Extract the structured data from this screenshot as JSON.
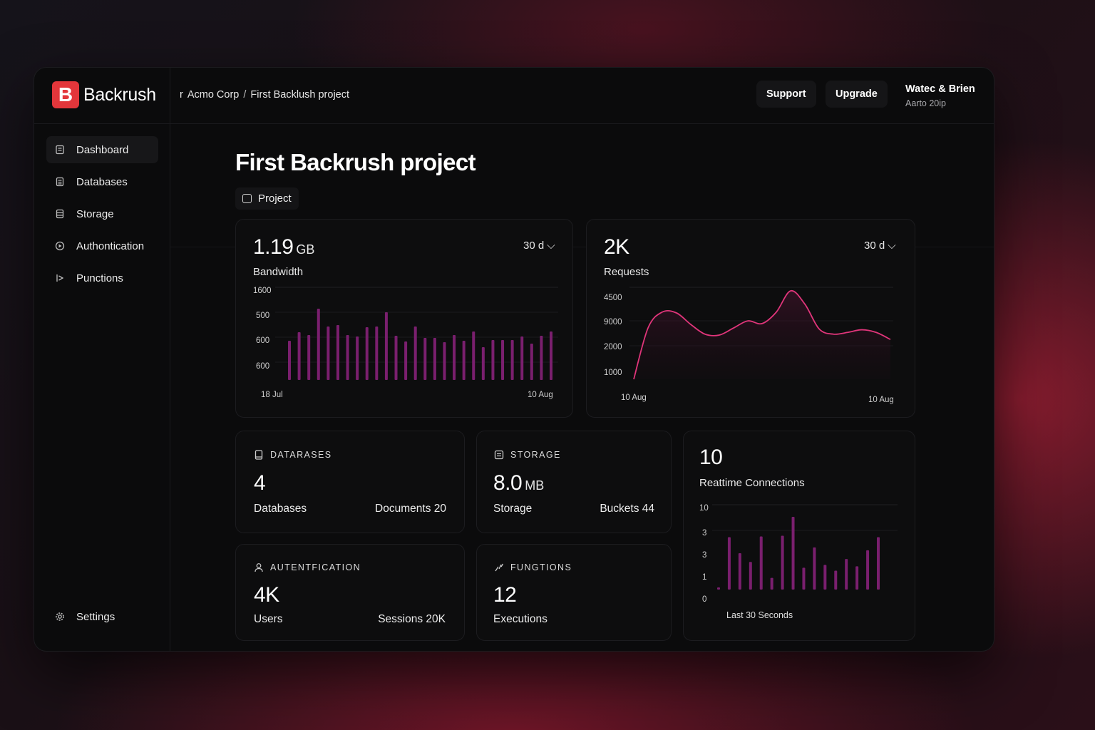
{
  "app": {
    "logo_letter": "B",
    "name": "Backrush",
    "brand_color": "#e3363b"
  },
  "breadcrumb": {
    "prefix": "r",
    "org": "Acmo Corp",
    "separator": "/",
    "project": "First Backlush project"
  },
  "header": {
    "support_label": "Support",
    "upgrade_label": "Upgrade",
    "user_name": "Watec & Brien",
    "user_sub": "Aarto 20ip"
  },
  "sidebar": {
    "items": [
      {
        "label": "Dashboard",
        "icon": "dashboard-icon",
        "active": true
      },
      {
        "label": "Databases",
        "icon": "database-icon"
      },
      {
        "label": "Storage",
        "icon": "storage-icon"
      },
      {
        "label": "Authontication",
        "icon": "auth-icon"
      },
      {
        "label": "Punctions",
        "icon": "functions-icon"
      }
    ],
    "settings_label": "Settings"
  },
  "page": {
    "title": "First Backrush project",
    "chip_label": "Project"
  },
  "bandwidth": {
    "value": "1.19",
    "unit": "GB",
    "label": "Bandwidth",
    "range": "30 d",
    "chevron": "⌵",
    "y_ticks": [
      "1600",
      "500",
      "600",
      "600"
    ],
    "x_start": "18 Jul",
    "x_end": "10 Aug"
  },
  "requests": {
    "value": "2K",
    "label": "Requests",
    "range": "30 d",
    "chevron": "⌵",
    "y_ticks": [
      "4500",
      "9000",
      "2000",
      "1000"
    ],
    "x_start": "10 Aug",
    "x_end": "10 Aug"
  },
  "databases": {
    "heading": "DATARASES",
    "value": "4",
    "label": "Databases",
    "secondary": "Documents 20"
  },
  "storage": {
    "heading": "STORAGE",
    "value": "8.0",
    "unit": "MB",
    "label": "Storage",
    "secondary": "Buckets 44"
  },
  "auth": {
    "heading": "AUTENTFICATION",
    "value": "4K",
    "label": "Users",
    "secondary": "Sessions 20K"
  },
  "functions": {
    "heading": "FUNGTIONS",
    "value": "12",
    "label": "Executions"
  },
  "realtime": {
    "value": "10",
    "label": "Reattime Connections",
    "y_ticks": [
      "10",
      "3",
      "3",
      "1",
      "0"
    ],
    "footer": "Last 30 Seconds"
  },
  "chart_data": [
    {
      "type": "bar",
      "name": "bandwidth",
      "x_start": "18 Jul",
      "x_end": "10 Aug",
      "y_tick_labels": [
        "1600",
        "500",
        "600",
        "600"
      ],
      "values": [
        0.55,
        0.67,
        0.63,
        1.0,
        0.75,
        0.77,
        0.63,
        0.61,
        0.74,
        0.75,
        0.95,
        0.62,
        0.54,
        0.75,
        0.59,
        0.59,
        0.53,
        0.63,
        0.55,
        0.68,
        0.46,
        0.56,
        0.56,
        0.56,
        0.61,
        0.51,
        0.62,
        0.68
      ],
      "bar_color": "#7a1f6e"
    },
    {
      "type": "area",
      "name": "requests",
      "x_start": "10 Aug",
      "x_end": "10 Aug",
      "y_tick_labels": [
        "4500",
        "9000",
        "2000",
        "1000"
      ],
      "values": [
        0.0,
        0.58,
        0.76,
        0.75,
        0.62,
        0.51,
        0.5,
        0.58,
        0.66,
        0.63,
        0.76,
        1.0,
        0.85,
        0.57,
        0.51,
        0.53,
        0.56,
        0.53,
        0.45
      ],
      "line_color": "#e0357a"
    },
    {
      "type": "bar",
      "name": "realtime",
      "y_tick_labels": [
        "10",
        "3",
        "3",
        "1",
        "0"
      ],
      "values": [
        0.02,
        0.72,
        0.5,
        0.38,
        0.73,
        0.16,
        0.74,
        1.0,
        0.3,
        0.58,
        0.34,
        0.26,
        0.42,
        0.32,
        0.54,
        0.72
      ],
      "footer": "Last 30 Seconds",
      "bar_color": "#7a1f6e"
    }
  ]
}
